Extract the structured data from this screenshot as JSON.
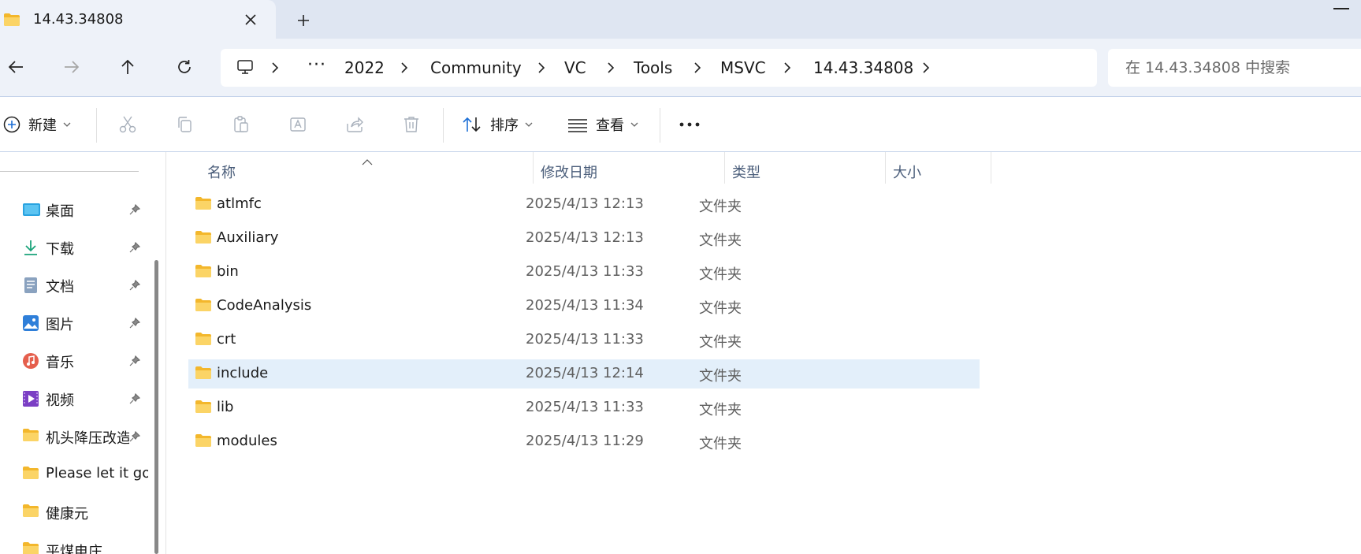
{
  "window": {
    "tab_title": "14.43.34808",
    "new_tab_label": "+"
  },
  "address": {
    "breadcrumbs": [
      "2022",
      "Community",
      "VC",
      "Tools",
      "MSVC",
      "14.43.34808"
    ],
    "overflow": "···"
  },
  "search": {
    "placeholder": "在 14.43.34808 中搜索"
  },
  "toolbar": {
    "new_label": "新建",
    "sort_label": "排序",
    "view_label": "查看",
    "more_label": "···"
  },
  "sidebar": {
    "items": [
      {
        "label": "桌面",
        "icon": "desktop-icon",
        "pinned": true
      },
      {
        "label": "下载",
        "icon": "download-icon",
        "pinned": true
      },
      {
        "label": "文档",
        "icon": "document-icon",
        "pinned": true
      },
      {
        "label": "图片",
        "icon": "pictures-icon",
        "pinned": true
      },
      {
        "label": "音乐",
        "icon": "music-icon",
        "pinned": true
      },
      {
        "label": "视频",
        "icon": "video-icon",
        "pinned": true
      },
      {
        "label": "机头降压改造",
        "icon": "folder-icon",
        "pinned": true
      },
      {
        "label": "Please let it go",
        "icon": "folder-icon",
        "pinned": false
      },
      {
        "label": "健康元",
        "icon": "folder-icon",
        "pinned": false
      },
      {
        "label": "平煤电庄",
        "icon": "folder-icon",
        "pinned": false
      }
    ]
  },
  "columns": {
    "name": "名称",
    "modified": "修改日期",
    "type": "类型",
    "size": "大小"
  },
  "files": [
    {
      "name": "atlmfc",
      "modified": "2025/4/13 12:13",
      "type": "文件夹",
      "selected": false
    },
    {
      "name": "Auxiliary",
      "modified": "2025/4/13 12:13",
      "type": "文件夹",
      "selected": false
    },
    {
      "name": "bin",
      "modified": "2025/4/13 11:33",
      "type": "文件夹",
      "selected": false
    },
    {
      "name": "CodeAnalysis",
      "modified": "2025/4/13 11:34",
      "type": "文件夹",
      "selected": false
    },
    {
      "name": "crt",
      "modified": "2025/4/13 11:33",
      "type": "文件夹",
      "selected": false
    },
    {
      "name": "include",
      "modified": "2025/4/13 12:14",
      "type": "文件夹",
      "selected": true
    },
    {
      "name": "lib",
      "modified": "2025/4/13 11:33",
      "type": "文件夹",
      "selected": false
    },
    {
      "name": "modules",
      "modified": "2025/4/13 11:29",
      "type": "文件夹",
      "selected": false
    }
  ],
  "colors": {
    "titlebar": "#dfe6f2",
    "chrome": "#eef2f9",
    "selection": "#e3effa",
    "folder": "#f7c84a"
  }
}
